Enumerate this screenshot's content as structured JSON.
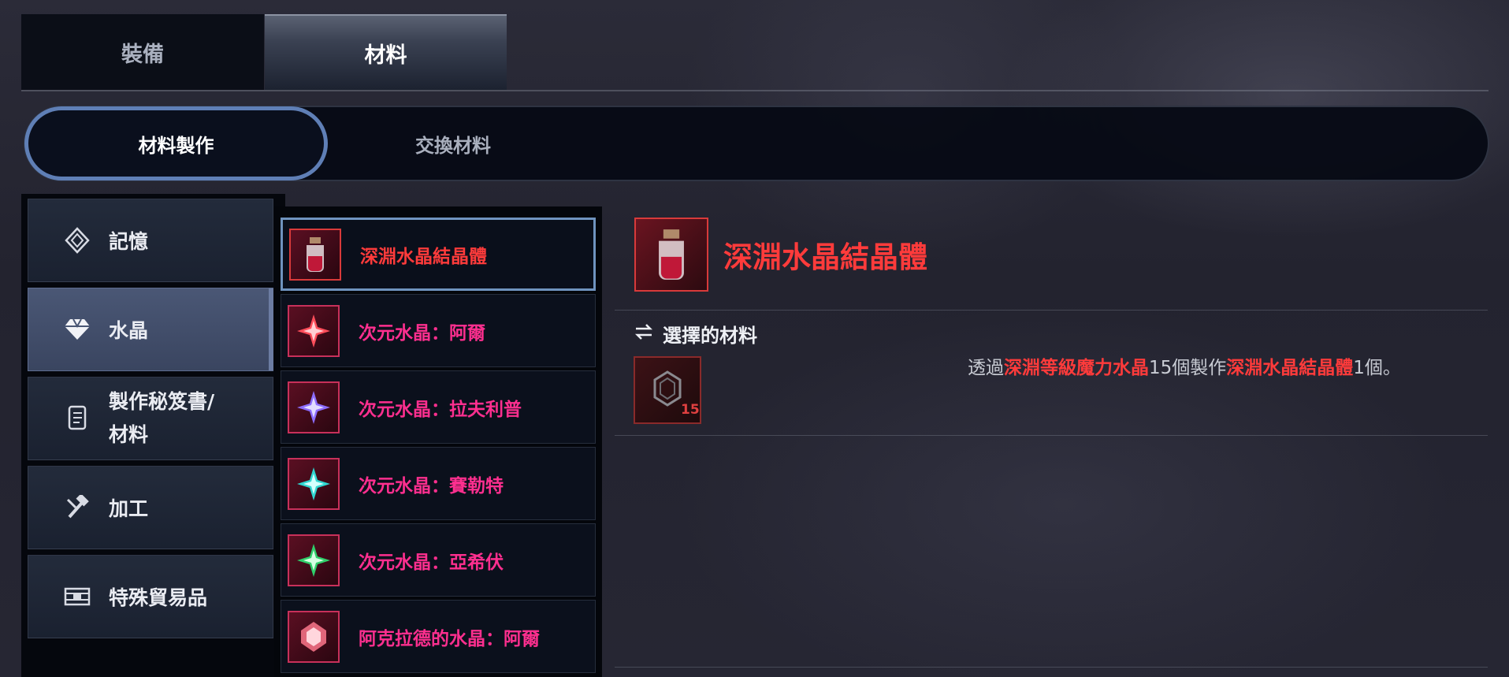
{
  "top_tabs": [
    {
      "label": "裝備",
      "active": false
    },
    {
      "label": "材料",
      "active": true
    }
  ],
  "sub_tabs": [
    {
      "label": "材料製作",
      "active": true
    },
    {
      "label": "交換材料",
      "active": false
    }
  ],
  "categories": [
    {
      "label": "記憶",
      "icon": "memory-icon",
      "active": false
    },
    {
      "label": "水晶",
      "icon": "diamond-icon",
      "active": true
    },
    {
      "label": "製作秘笈書/",
      "label2": "材料",
      "icon": "scroll-icon",
      "active": false
    },
    {
      "label": "加工",
      "icon": "hammer-icon",
      "active": false
    },
    {
      "label": "特殊貿易品",
      "icon": "trade-goods-icon",
      "active": false
    }
  ],
  "materials": [
    {
      "name": "深淵水晶結晶體",
      "color": "#ff3b3b",
      "icon": "red-potion-jar-icon",
      "selected": true
    },
    {
      "name": "次元水晶：阿爾",
      "color": "#ff2f8f",
      "icon": "red-crystal-icon",
      "selected": false
    },
    {
      "name": "次元水晶：拉夫利普",
      "color": "#ff2f8f",
      "icon": "purple-crystal-icon",
      "selected": false
    },
    {
      "name": "次元水晶：賽勒特",
      "color": "#ff2f8f",
      "icon": "cyan-crystal-icon",
      "selected": false
    },
    {
      "name": "次元水晶：亞希伏",
      "color": "#ff2f8f",
      "icon": "green-crystal-icon",
      "selected": false
    },
    {
      "name": "阿克拉德的水晶：阿爾",
      "color": "#ff2f8f",
      "icon": "pink-gem-icon",
      "selected": false
    }
  ],
  "detail": {
    "title": "深淵水晶結晶體",
    "selected_materials_label": "選擇的材料",
    "material_quantity": "15",
    "desc_prefix": "透過",
    "desc_material": "深淵等級魔力水晶",
    "desc_mid": "15個製作",
    "desc_product": "深淵水晶結晶體",
    "desc_suffix": "1個。"
  },
  "colors": {
    "accent_red": "#ff3b3b",
    "accent_pink": "#ff2f8f",
    "tab_highlight": "#5f7fb6"
  }
}
